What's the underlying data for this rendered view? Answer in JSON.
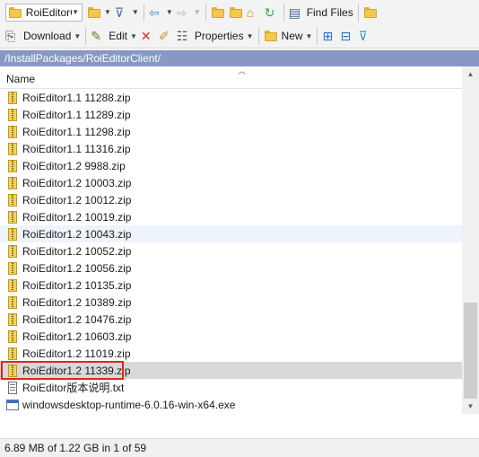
{
  "toolbar1": {
    "location_combo": {
      "value": "RoiEditorC",
      "icon": "folder-icon"
    },
    "find_files_label": "Find Files"
  },
  "toolbar2": {
    "download_label": "Download",
    "edit_label": "Edit",
    "properties_label": "Properties",
    "new_label": "New"
  },
  "path": "/InstallPackages/RoiEditorClient/",
  "columns": {
    "name": "Name"
  },
  "files": [
    {
      "name": "RoiEditor1.1 11288.zip",
      "type": "zip"
    },
    {
      "name": "RoiEditor1.1 11289.zip",
      "type": "zip"
    },
    {
      "name": "RoiEditor1.1 11298.zip",
      "type": "zip"
    },
    {
      "name": "RoiEditor1.1 11316.zip",
      "type": "zip"
    },
    {
      "name": "RoiEditor1.2 9988.zip",
      "type": "zip"
    },
    {
      "name": "RoiEditor1.2 10003.zip",
      "type": "zip"
    },
    {
      "name": "RoiEditor1.2 10012.zip",
      "type": "zip"
    },
    {
      "name": "RoiEditor1.2 10019.zip",
      "type": "zip"
    },
    {
      "name": "RoiEditor1.2 10043.zip",
      "type": "zip",
      "state": "hover"
    },
    {
      "name": "RoiEditor1.2 10052.zip",
      "type": "zip"
    },
    {
      "name": "RoiEditor1.2 10056.zip",
      "type": "zip"
    },
    {
      "name": "RoiEditor1.2 10135.zip",
      "type": "zip"
    },
    {
      "name": "RoiEditor1.2 10389.zip",
      "type": "zip"
    },
    {
      "name": "RoiEditor1.2 10476.zip",
      "type": "zip"
    },
    {
      "name": "RoiEditor1.2 10603.zip",
      "type": "zip"
    },
    {
      "name": "RoiEditor1.2 11019.zip",
      "type": "zip"
    },
    {
      "name": "RoiEditor1.2 11339.zip",
      "type": "zip",
      "state": "selected"
    },
    {
      "name": "RoiEditor版本说明.txt",
      "type": "txt"
    },
    {
      "name": "windowsdesktop-runtime-6.0.16-win-x64.exe",
      "type": "exe"
    }
  ],
  "status": "6.89 MB of 1.22 GB in 1 of 59",
  "colors": {
    "path_bar": "#8798c4",
    "selection": "#d9d9d9",
    "highlight_border": "#e0261c",
    "hover": "#eef4fb"
  }
}
